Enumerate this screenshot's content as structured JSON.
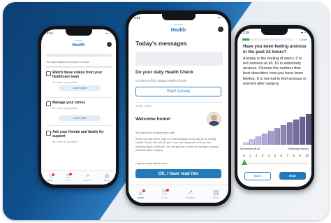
{
  "brand": {
    "logo_text": "Health",
    "accent": "#2c6cb0",
    "bg_dark": "#0d3f73",
    "bar_color": "#7e72b5"
  },
  "left_phone": {
    "time": "2:14",
    "checklist_header": "You have finished 0% of your to-do list",
    "items": [
      {
        "title": "Watch these videos from your healthcare team",
        "sub": "As soon as possible",
        "button": "Learn more"
      },
      {
        "title": "Manage your stress",
        "sub": "As soon as possible",
        "button": "Learn how"
      },
      {
        "title": "Ask your friends and family for support",
        "sub": "As soon as possible"
      }
    ],
    "tabs": [
      "Home",
      "To-do",
      "Progress",
      "Books"
    ]
  },
  "middle_phone": {
    "time": "2:21",
    "heading": "Today's messages",
    "health_check_title": "Do your daily Health Check",
    "health_check_body": "It is time to fill in today's Health Check!",
    "start_button": "Start survey",
    "date": "APRIL 1 2023",
    "welcome_title": "Welcome home!",
    "welcome_p1": "We hope your surgery went well!",
    "welcome_p2": "When you get home, sign in to this program every day to do a daily Health Check. We will tell you if you are doing well or if you are showing signs of trouble. You will get tips on how to manage common problems after surgery.",
    "welcome_p3": "Hope you feel better soon!",
    "ok_button": "OK, I have read this",
    "tabs": [
      "Home",
      "To-do",
      "Progress",
      "Books"
    ]
  },
  "right_phone": {
    "time": "2:28",
    "close_label": "Close",
    "question": "Have you been feeling anxious in the past 24 hours?",
    "explanation": "Anxiety is the feeling of worry. 0 is not anxious at all. 10 is extremely anxious. Choose the number that best describes how you have been feeling. It is normal to feel anxious or worried after surgery.",
    "scale_min_label": "Not anxious at all",
    "scale_max_label": "Extremely anxious",
    "scale_numbers": [
      "0",
      "1",
      "2",
      "3",
      "4",
      "5",
      "6",
      "7",
      "8",
      "9",
      "10"
    ],
    "selected_value": 0,
    "bar_levels": [
      0,
      1,
      2,
      3,
      4,
      5,
      6,
      7,
      8,
      9,
      10
    ],
    "back_button": "Back",
    "next_button": "Next"
  }
}
